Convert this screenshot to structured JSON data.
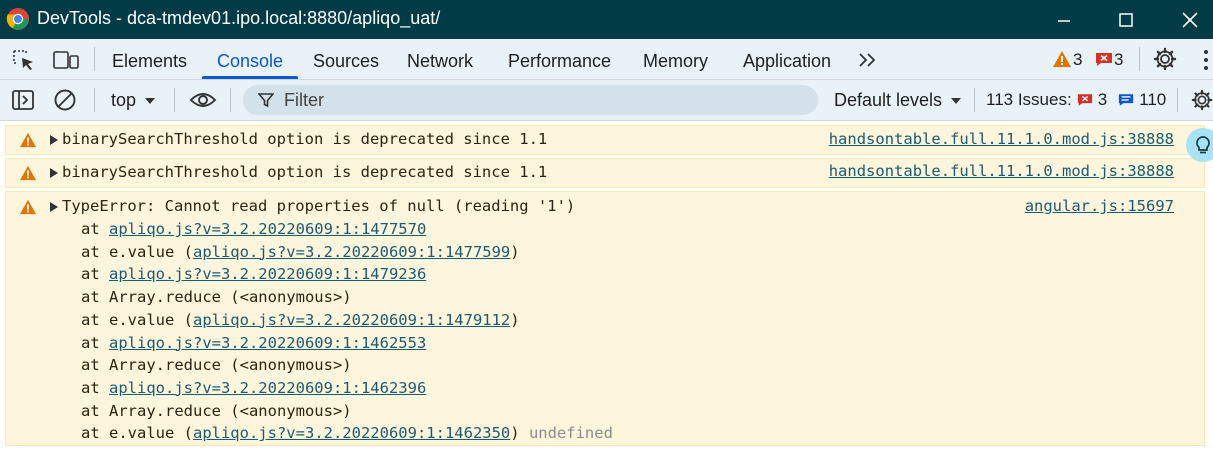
{
  "window": {
    "title": "DevTools - dca-tmdev01.ipo.local:8880/apliqo_uat/"
  },
  "tabs": [
    "Elements",
    "Console",
    "Sources",
    "Network",
    "Performance",
    "Memory",
    "Application"
  ],
  "counts": {
    "warnings": "3",
    "errors": "3"
  },
  "toolbar": {
    "context": "top",
    "filter_placeholder": "Filter",
    "levels": "Default levels",
    "issues_label": "113 Issues:",
    "issues_errors": "3",
    "issues_info": "110"
  },
  "messages": [
    {
      "text": "binarySearchThreshold option is deprecated since 1.1",
      "source": "handsontable.full.11.1.0.mod.js:38888"
    },
    {
      "text": "binarySearchThreshold option is deprecated since 1.1",
      "source": "handsontable.full.11.1.0.mod.js:38888"
    },
    {
      "text": "TypeError: Cannot read properties of null (reading '1')",
      "source": "angular.js:15697"
    }
  ],
  "stack": [
    {
      "prefix": "at ",
      "link": "apliqo.js?v=3.2.20220609:1:1477570",
      "suffix": ""
    },
    {
      "prefix": "at e.value (",
      "link": "apliqo.js?v=3.2.20220609:1:1477599",
      "suffix": ")"
    },
    {
      "prefix": "at ",
      "link": "apliqo.js?v=3.2.20220609:1:1479236",
      "suffix": ""
    },
    {
      "prefix": "at Array.reduce (<anonymous>)",
      "link": "",
      "suffix": ""
    },
    {
      "prefix": "at e.value (",
      "link": "apliqo.js?v=3.2.20220609:1:1479112",
      "suffix": ")"
    },
    {
      "prefix": "at ",
      "link": "apliqo.js?v=3.2.20220609:1:1462553",
      "suffix": ""
    },
    {
      "prefix": "at Array.reduce (<anonymous>)",
      "link": "",
      "suffix": ""
    },
    {
      "prefix": "at ",
      "link": "apliqo.js?v=3.2.20220609:1:1462396",
      "suffix": ""
    },
    {
      "prefix": "at Array.reduce (<anonymous>)",
      "link": "",
      "suffix": ""
    },
    {
      "prefix": "at e.value (",
      "link": "apliqo.js?v=3.2.20220609:1:1462350",
      "suffix": ")"
    }
  ],
  "trailing": "undefined",
  "colors": {
    "titlebar": "#003b46",
    "accent": "#0b57d0",
    "warning_bg": "#fdf6dc",
    "warning_icon": "#e37400",
    "error_badge": "#d93025"
  }
}
